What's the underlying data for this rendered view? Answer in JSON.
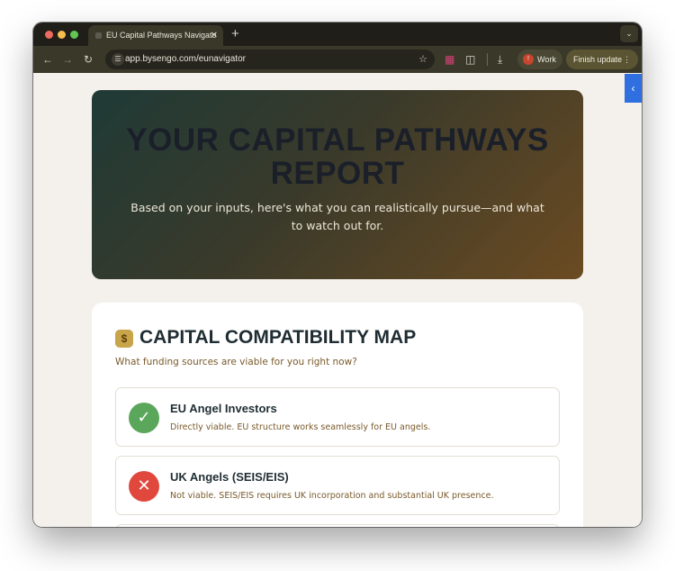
{
  "browser": {
    "tab_title": "EU Capital Pathways Navigato",
    "tab_close": "✕",
    "new_tab": "+",
    "url": "app.bysengo.com/eunavigator",
    "profile_label": "Work",
    "profile_initial": "!",
    "update_label": "Finish update"
  },
  "hero": {
    "title": "YOUR CAPITAL PATHWAYS REPORT",
    "subtitle": "Based on your inputs, here's what you can realistically pursue—and what to watch out for."
  },
  "compatibility": {
    "icon": "💰",
    "title": "CAPITAL COMPATIBILITY MAP",
    "subtitle": "What funding sources are viable for you right now?",
    "items": [
      {
        "name": "EU Angel Investors",
        "desc": "Directly viable. EU structure works seamlessly for EU angels.",
        "status": "viable",
        "symbol": "✓"
      },
      {
        "name": "UK Angels (SEIS/EIS)",
        "desc": "Not viable. SEIS/EIS requires UK incorporation and substantial UK presence.",
        "status": "not-viable",
        "symbol": "✕"
      }
    ]
  },
  "colors": {
    "viable": "#5aa65a",
    "not_viable": "#e0483d",
    "side_toggle": "#2f6fe0"
  }
}
